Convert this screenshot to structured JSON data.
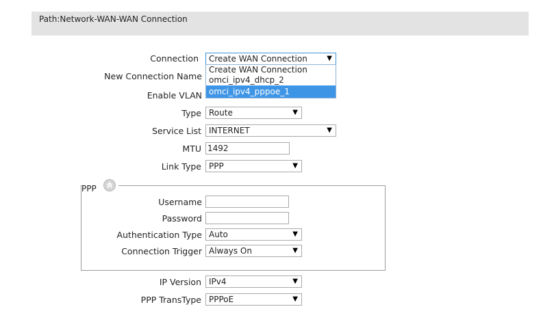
{
  "path": "Path:Network-WAN-WAN Connection",
  "form": {
    "connection": {
      "label": "Connection",
      "value": "Create WAN Connection"
    },
    "connection_options": [
      "Create WAN Connection",
      "omci_ipv4_dhcp_2",
      "omci_ipv4_pppoe_1"
    ],
    "new_connection_name": {
      "label": "New Connection Name"
    },
    "enable_vlan": {
      "label": "Enable VLAN"
    },
    "type": {
      "label": "Type",
      "value": "Route"
    },
    "service_list": {
      "label": "Service List",
      "value": "INTERNET"
    },
    "mtu": {
      "label": "MTU",
      "value": "1492"
    },
    "link_type": {
      "label": "Link Type",
      "value": "PPP"
    }
  },
  "ppp": {
    "legend": "PPP",
    "username": {
      "label": "Username",
      "value": ""
    },
    "password": {
      "label": "Password",
      "value": ""
    },
    "auth_type": {
      "label": "Authentication Type",
      "value": "Auto"
    },
    "conn_trigger": {
      "label": "Connection Trigger",
      "value": "Always On"
    }
  },
  "ip_version": {
    "label": "IP Version",
    "value": "IPv4"
  },
  "ppp_transtype": {
    "label": "PPP TransType",
    "value": "PPPoE"
  },
  "icons": {
    "select_arrow": "▼",
    "collapse": "collapse-up-icon"
  },
  "colors": {
    "highlight": "#3e95e6",
    "path_bar": "#e3e3e3"
  }
}
